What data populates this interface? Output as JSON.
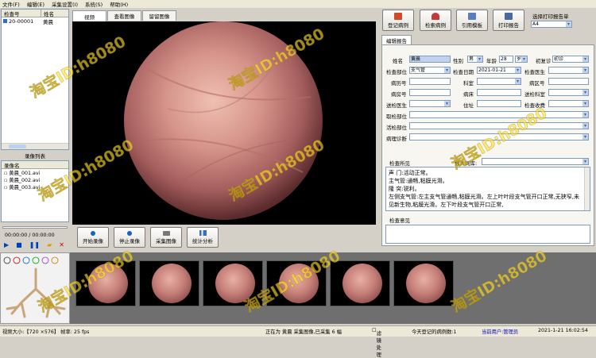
{
  "menu": [
    "文件(F)",
    "编辑(E)",
    "采集设置(I)",
    "系统(S)",
    "帮助(H)"
  ],
  "patient_list": {
    "col1": "检查号",
    "col2": "姓名",
    "rows": [
      {
        "id": "20-00001",
        "name": "黄晨"
      }
    ]
  },
  "video_list": {
    "title": "录像列表",
    "col": "录像名",
    "files": [
      "黄晨_001.avi",
      "黄晨_002.avi",
      "黄晨_003.avi"
    ],
    "time": "00:00:00 / 00:00:00"
  },
  "center_tabs": [
    "视频",
    "查看图像",
    "留留图像"
  ],
  "video_buttons": [
    "开始录像",
    "停止录像",
    "采集图像",
    "统计分析"
  ],
  "toolbar": {
    "btn1": "登记病例",
    "btn2": "检索病例",
    "btn3": "引用模板",
    "btn4": "打印报告",
    "select_label": "选择打印报告单",
    "select_value": "A4"
  },
  "report_tab": "编辑报告",
  "form": {
    "name_label": "姓名",
    "name_value": "黄晨",
    "sex_label": "性别",
    "sex_value": "男",
    "age_label": "年龄",
    "age_value": "28",
    "age_unit": "岁",
    "visit_label": "初复诊",
    "visit_value": "初诊",
    "part_label": "检查部位",
    "part_value": "支气管",
    "date_label": "检查日期",
    "date_value": "2021-01-21",
    "doctor_label": "检查医生",
    "case_label": "病历号",
    "dept_label": "科室",
    "ward_label": "病区号",
    "inpatient_label": "病房号",
    "bed_label": "病床",
    "send_dept_label": "送检科室",
    "send_doc_label": "送检医生",
    "addr_label": "住址",
    "fee_label": "检查收费",
    "part2_label": "取检部位",
    "live_label": "活检部位",
    "diag_label": "病理诊断"
  },
  "findings": {
    "label": "检查所见",
    "insert_label": "插入词库:",
    "text": [
      "声  门:活动正常。",
      "主气管:通畅,粘膜光滑。",
      "隆  突:锐利。",
      "左侧支气管:左主支气管通畅,粘膜光滑。左上叶叶段支气管开口正常,无狭窄,未见新生物,粘膜光滑。左下叶段支气管开口正常,"
    ]
  },
  "opinion_label": "检查意见",
  "watermark": "淘宝ID:h8080",
  "status": {
    "video_size": "视频大小:【720 ×576】 帧率: 25 fps",
    "recording": "正在为 黄晨 采集图像,已采集 6 幅",
    "filter": "滤镜处理",
    "today": "今天登记的病例数:1",
    "user": "当前用户:管理员",
    "datetime": "2021-1-21  16:02:54"
  },
  "colors": {
    "accent": "#316ac5",
    "video_bg": "#000000",
    "user_text": "#0000cc"
  }
}
